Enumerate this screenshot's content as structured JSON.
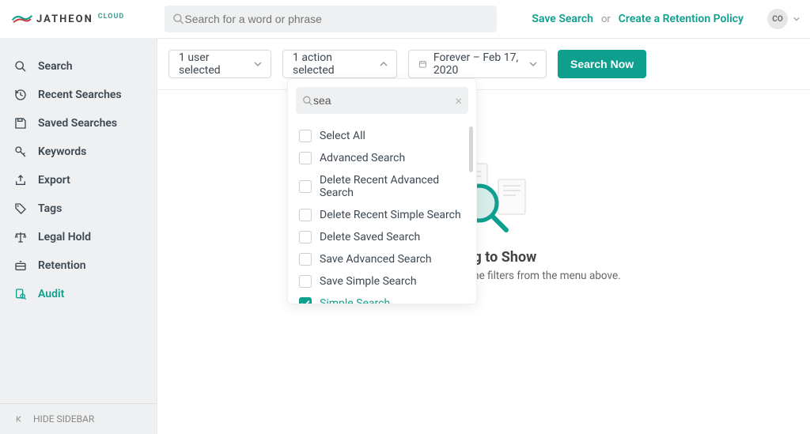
{
  "brand": {
    "name": "JATHEON",
    "suffix": "CLOUD"
  },
  "header": {
    "search_placeholder": "Search for a word or phrase",
    "save_search": "Save Search",
    "or": "or",
    "create_policy": "Create a Retention Policy",
    "avatar_initials": "CO"
  },
  "sidebar": {
    "items": [
      {
        "id": "search",
        "label": "Search",
        "icon": "search"
      },
      {
        "id": "recent",
        "label": "Recent Searches",
        "icon": "history"
      },
      {
        "id": "saved",
        "label": "Saved Searches",
        "icon": "save"
      },
      {
        "id": "keywords",
        "label": "Keywords",
        "icon": "key"
      },
      {
        "id": "export",
        "label": "Export",
        "icon": "export"
      },
      {
        "id": "tags",
        "label": "Tags",
        "icon": "tag"
      },
      {
        "id": "legalhold",
        "label": "Legal Hold",
        "icon": "scales"
      },
      {
        "id": "retention",
        "label": "Retention",
        "icon": "retention"
      },
      {
        "id": "audit",
        "label": "Audit",
        "icon": "audit",
        "active": true
      }
    ],
    "footer": "HIDE SIDEBAR"
  },
  "filters": {
    "users": "1 user selected",
    "actions": "1 action selected",
    "date": "Forever – Feb 17, 2020",
    "button": "Search Now"
  },
  "action_dropdown": {
    "filter_value": "sea",
    "options": [
      {
        "label": "Select All",
        "checked": false
      },
      {
        "label": "Advanced Search",
        "checked": false
      },
      {
        "label": "Delete Recent Advanced Search",
        "checked": false
      },
      {
        "label": "Delete Recent Simple Search",
        "checked": false
      },
      {
        "label": "Delete Saved Search",
        "checked": false
      },
      {
        "label": "Save Advanced Search",
        "checked": false
      },
      {
        "label": "Save Simple Search",
        "checked": false
      },
      {
        "label": "Simple Search",
        "checked": true
      }
    ]
  },
  "empty": {
    "title": "Nothing to Show",
    "subtitle": "To see audit logs, choose the filters from the menu above."
  },
  "colors": {
    "accent": "#0e9f8e"
  }
}
